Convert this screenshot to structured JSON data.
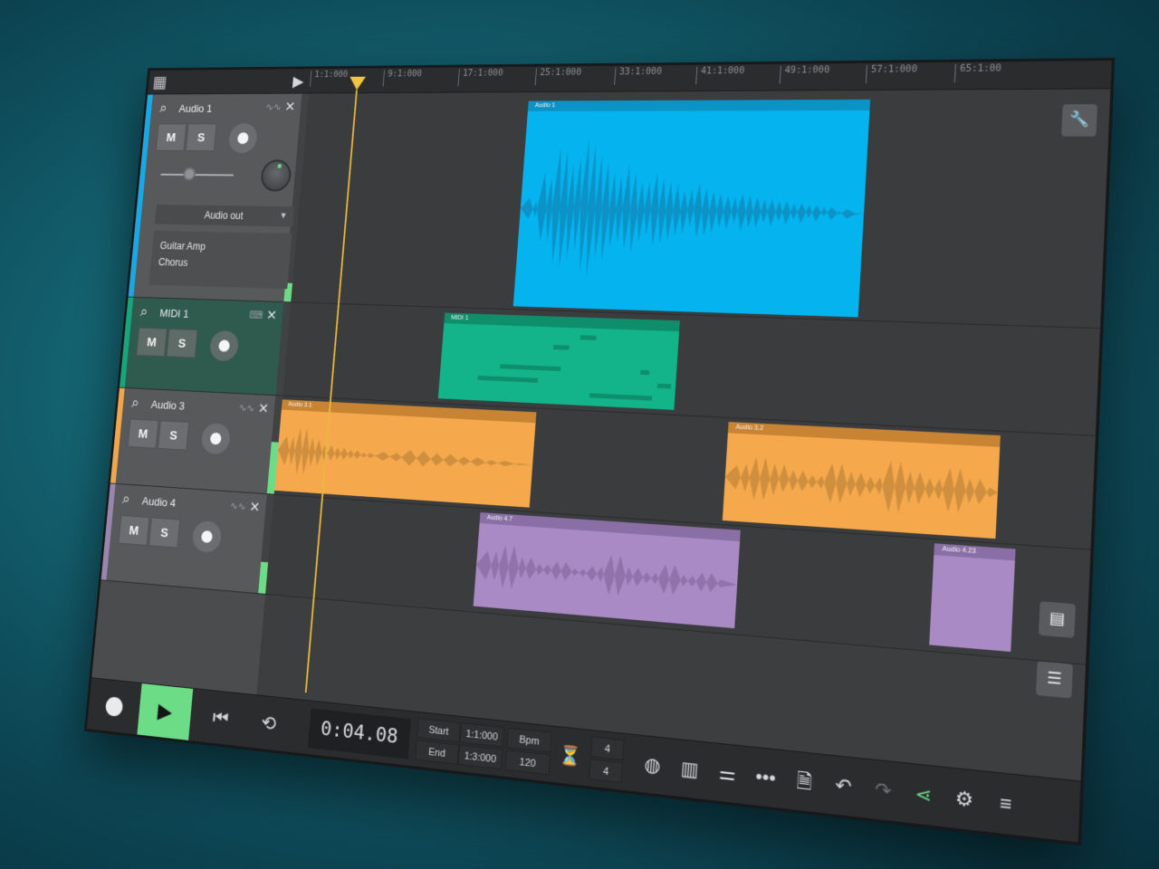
{
  "ruler": {
    "ticks": [
      "1:1:000",
      "9:1:000",
      "17:1:000",
      "25:1:000",
      "33:1:000",
      "41:1:000",
      "49:1:000",
      "57:1:000",
      "65:1:00"
    ]
  },
  "tracks": [
    {
      "name": "Audio 1",
      "mute": "M",
      "solo": "S",
      "output": "Audio out",
      "effects": [
        "Guitar Amp",
        "Chorus"
      ],
      "color": "#1ba7e3"
    },
    {
      "name": "MIDI 1",
      "mute": "M",
      "solo": "S",
      "color": "#17a57b"
    },
    {
      "name": "Audio 3",
      "mute": "M",
      "solo": "S",
      "color": "#f0a64b"
    },
    {
      "name": "Audio 4",
      "mute": "M",
      "solo": "S",
      "color": "#9a85ad"
    }
  ],
  "clips": {
    "audio1": "Audio 1",
    "midi1": "MIDI 1",
    "audio3_1": "Audio 3.1",
    "audio3_2": "Audio 3.2",
    "audio4_7": "Audio 4.7",
    "audio4_23": "Audio 4.23"
  },
  "transport": {
    "time": "0:04.08",
    "start_label": "Start",
    "start_value": "1:1:000",
    "end_label": "End",
    "end_value": "1:3:000",
    "bpm_label": "Bpm",
    "bpm_value": "120",
    "sig_top": "4",
    "sig_bottom": "4"
  },
  "icons": {
    "grid": "grid-icon",
    "play": "play-icon",
    "wrench": "wrench-icon",
    "search": "search-icon",
    "close": "close-icon"
  },
  "colors": {
    "accent": "#6ddc86",
    "playhead": "#e8b83e",
    "audio1": "#05b4ef",
    "midi1": "#13b489",
    "audio3": "#f5a94c",
    "audio4": "#a98ac5"
  }
}
